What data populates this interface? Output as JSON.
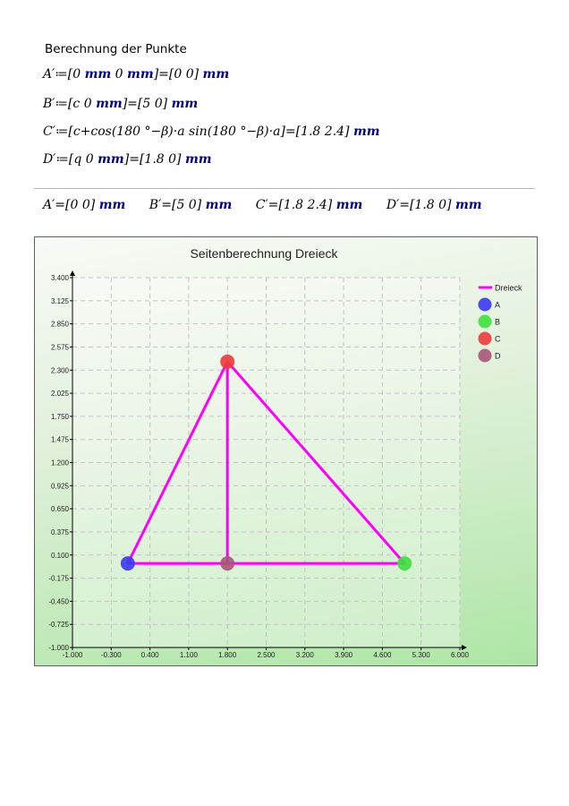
{
  "section": {
    "heading": "Berechnung der Punkte"
  },
  "definitions": [
    {
      "lhs": "A′",
      "assign": "≔",
      "expr": "[0 ",
      "expr_unit": "mm",
      "expr2": " 0 ",
      "expr_unit2": "mm",
      "expr3": "]",
      "eq": "=",
      "result": "[0  0]",
      "unit": "mm"
    },
    {
      "lhs": "B′",
      "assign": "≔",
      "expr": "[c  0 ",
      "expr_unit": "mm",
      "expr2": "",
      "expr_unit2": "",
      "expr3": "]",
      "eq": "=",
      "result": "[5  0]",
      "unit": "mm"
    },
    {
      "lhs": "C′",
      "assign": "≔",
      "expr": "[c+cos(180 °−β)·a  sin(180 °−β)·a]",
      "expr_unit": "",
      "expr2": "",
      "expr_unit2": "",
      "expr3": "",
      "eq": "=",
      "result": "[1.8  2.4]",
      "unit": "mm"
    },
    {
      "lhs": "D′",
      "assign": "≔",
      "expr": "[q  0 ",
      "expr_unit": "mm",
      "expr2": "",
      "expr_unit2": "",
      "expr3": "]",
      "eq": "=",
      "result": "[1.8  0]",
      "unit": "mm"
    }
  ],
  "results": [
    {
      "lhs": "A′",
      "eq": "=",
      "value": "[0  0]",
      "unit": "mm"
    },
    {
      "lhs": "B′",
      "eq": "=",
      "value": "[5  0]",
      "unit": "mm"
    },
    {
      "lhs": "C′",
      "eq": "=",
      "value": "[1.8  2.4]",
      "unit": "mm"
    },
    {
      "lhs": "D′",
      "eq": "=",
      "value": "[1.8  0]",
      "unit": "mm"
    }
  ],
  "chart_data": {
    "type": "scatter",
    "title": "Seitenberechnung Dreieck",
    "xlim": [
      -1.0,
      6.0
    ],
    "ylim": [
      -1.0,
      3.4
    ],
    "x_ticks": [
      "-1.000",
      "-0.300",
      "0.400",
      "1.100",
      "1.800",
      "2.500",
      "3.200",
      "3.900",
      "4.600",
      "5.300",
      "6.000"
    ],
    "y_ticks": [
      "3.400",
      "3.125",
      "2.850",
      "2.575",
      "2.300",
      "2.025",
      "1.750",
      "1.475",
      "1.200",
      "0.925",
      "0.650",
      "0.375",
      "0.100",
      "-0.175",
      "-0.450",
      "-0.725",
      "-1.000"
    ],
    "grid": true,
    "legend_position": "right",
    "series": [
      {
        "name": "Dreieck",
        "kind": "line",
        "color": "#ff00ff",
        "x": [
          0,
          5,
          1.8,
          0,
          1.8,
          1.8
        ],
        "y": [
          0,
          0,
          2.4,
          0,
          0,
          2.4
        ]
      },
      {
        "name": "A",
        "kind": "point",
        "color": "#3a3af0",
        "x": [
          0
        ],
        "y": [
          0
        ]
      },
      {
        "name": "B",
        "kind": "point",
        "color": "#3ee03e",
        "x": [
          5
        ],
        "y": [
          0
        ]
      },
      {
        "name": "C",
        "kind": "point",
        "color": "#ee3a3a",
        "x": [
          1.8
        ],
        "y": [
          2.4
        ]
      },
      {
        "name": "D",
        "kind": "point",
        "color": "#a8557a",
        "x": [
          1.8
        ],
        "y": [
          0
        ]
      }
    ]
  }
}
